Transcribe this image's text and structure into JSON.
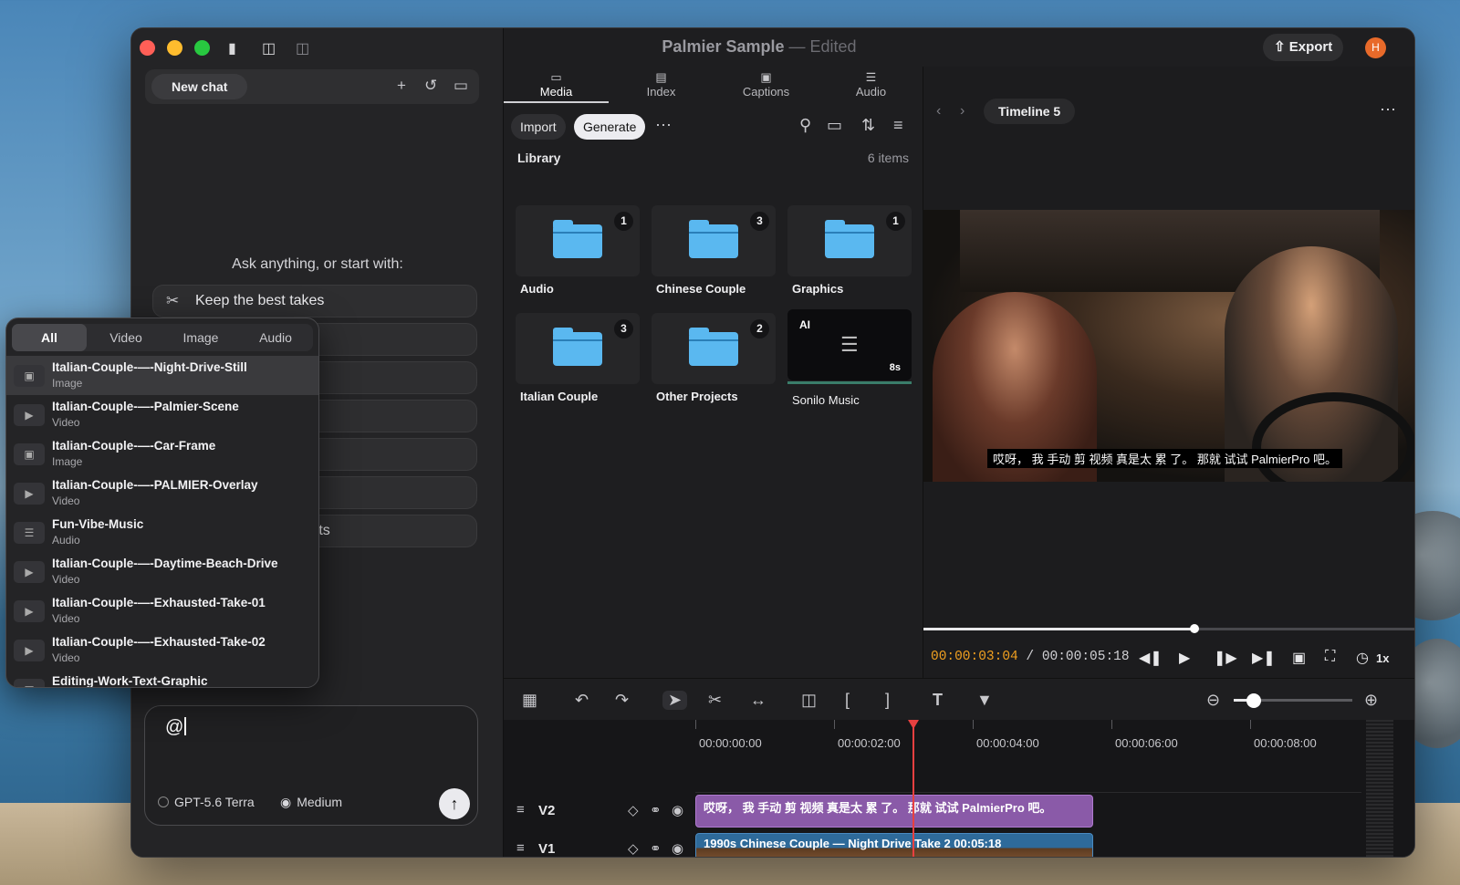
{
  "window": {
    "title": "Palmier Sample",
    "title_sep": "—",
    "status": "Edited"
  },
  "chat": {
    "new_chat_label": "New chat",
    "prompt_heading": "Ask anything, or start with:",
    "suggestions": [
      {
        "label": "Keep the best takes",
        "icon": "scissors-icon"
      },
      {
        "label": "n"
      },
      {
        "label": ""
      },
      {
        "label": ""
      },
      {
        "label": ""
      },
      {
        "label": ""
      },
      {
        "label": "rts"
      }
    ],
    "composer_text": "@",
    "model": "GPT-5.6 Terra",
    "effort": "Medium"
  },
  "mention_popup": {
    "tabs": [
      "All",
      "Video",
      "Image",
      "Audio"
    ],
    "active_tab": "All",
    "items": [
      {
        "name": "Italian-Couple-—-Night-Drive-Still",
        "type": "Image",
        "icon": "image-icon"
      },
      {
        "name": "Italian-Couple-—-Palmier-Scene",
        "type": "Video",
        "icon": "video-icon"
      },
      {
        "name": "Italian-Couple-—-Car-Frame",
        "type": "Image",
        "icon": "image-icon"
      },
      {
        "name": "Italian-Couple-—-PALMIER-Overlay",
        "type": "Video",
        "icon": "video-icon"
      },
      {
        "name": "Fun-Vibe-Music",
        "type": "Audio",
        "icon": "waveform-icon"
      },
      {
        "name": "Italian-Couple-—-Daytime-Beach-Drive",
        "type": "Video",
        "icon": "video-icon"
      },
      {
        "name": "Italian-Couple-—-Exhausted-Take-01",
        "type": "Video",
        "icon": "video-icon"
      },
      {
        "name": "Italian-Couple-—-Exhausted-Take-02",
        "type": "Video",
        "icon": "video-icon"
      },
      {
        "name": "Editing-Work-Text-Graphic",
        "type": "",
        "icon": "image-icon"
      }
    ]
  },
  "media": {
    "tabs": [
      {
        "label": "Media",
        "icon": "folder-icon"
      },
      {
        "label": "Index",
        "icon": "index-icon"
      },
      {
        "label": "Captions",
        "icon": "captions-icon"
      },
      {
        "label": "Audio",
        "icon": "waveform-icon"
      }
    ],
    "import_label": "Import",
    "generate_label": "Generate",
    "library_label": "Library",
    "item_count": "6 items",
    "folders": [
      {
        "label": "Audio",
        "count": "1"
      },
      {
        "label": "Chinese Couple",
        "count": "3"
      },
      {
        "label": "Graphics",
        "count": "1"
      },
      {
        "label": "Italian Couple",
        "count": "3"
      },
      {
        "label": "Other Projects",
        "count": "2"
      }
    ],
    "ai_item": {
      "badge": "AI",
      "duration": "8s",
      "label": "Sonilo Music"
    }
  },
  "header": {
    "export_label": "Export",
    "avatar_initial": "H"
  },
  "preview": {
    "timeline_name": "Timeline 5",
    "subtitle": "哎呀， 我 手动 剪 视频 真是太 累 了。 那就 试试 PalmierPro 吧。",
    "current_time": "00:00:03:04",
    "time_sep": "/",
    "total_time": "00:00:05:18",
    "speed": "1x",
    "progress": 0.55
  },
  "timeline": {
    "ruler_labels": [
      "00:00:00:00",
      "00:00:02:00",
      "00:00:04:00",
      "00:00:06:00",
      "00:00:08:00"
    ],
    "tracks": [
      {
        "name": "V2",
        "clip": "哎呀， 我 手动 剪 视频 真是太 累 了。 那就 试试 PalmierPro 吧。",
        "color": "#8a5aa8"
      },
      {
        "name": "V1",
        "clip": "1990s Chinese Couple — Night Drive Take 2  00:05:18",
        "color": "#2e6a9a"
      }
    ]
  }
}
